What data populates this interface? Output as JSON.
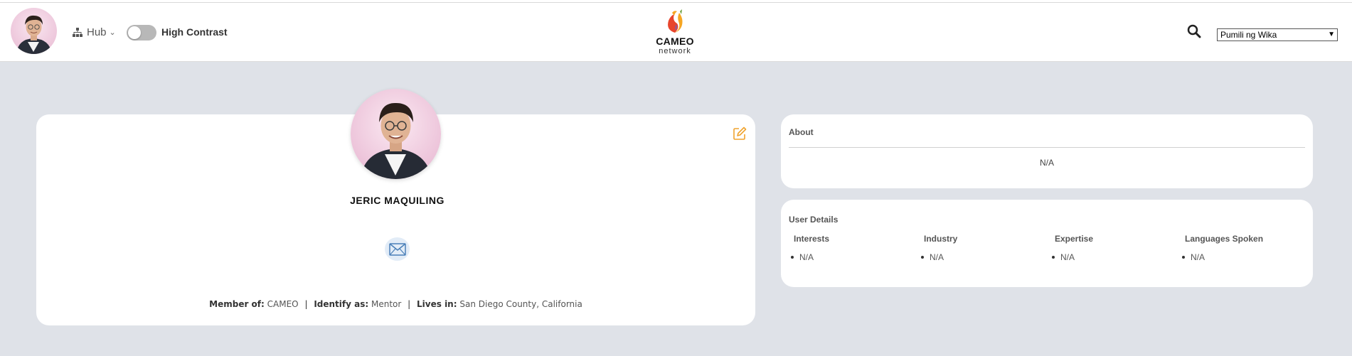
{
  "header": {
    "hub_label": "Hub",
    "high_contrast_label": "High Contrast",
    "logo": {
      "name": "CAMEO",
      "sub": "network"
    },
    "language_select": {
      "selected": "Pumili ng Wika"
    }
  },
  "profile": {
    "name": "JERIC MAQUILING",
    "member_of_label": "Member of:",
    "member_of": "CAMEO",
    "identify_as_label": "Identify as:",
    "identify_as": "Mentor",
    "lives_in_label": "Lives in:",
    "lives_in": "San Diego County, California"
  },
  "about": {
    "title": "About",
    "value": "N/A"
  },
  "user_details": {
    "title": "User Details",
    "columns": [
      {
        "heading": "Interests",
        "items": [
          "N/A"
        ]
      },
      {
        "heading": "Industry",
        "items": [
          "N/A"
        ]
      },
      {
        "heading": "Expertise",
        "items": [
          "N/A"
        ]
      },
      {
        "heading": "Languages Spoken",
        "items": [
          "N/A"
        ]
      }
    ]
  },
  "colors": {
    "page_bg": "#dfe2e8",
    "card_bg": "#ffffff",
    "edit_icon": "#f0a32e",
    "mail_bg": "#e2ecf7",
    "mail_icon": "#4a7fb8"
  },
  "icons": {
    "hub": "sitemap-icon",
    "search": "search-icon",
    "edit": "edit-icon",
    "mail": "envelope-icon"
  }
}
